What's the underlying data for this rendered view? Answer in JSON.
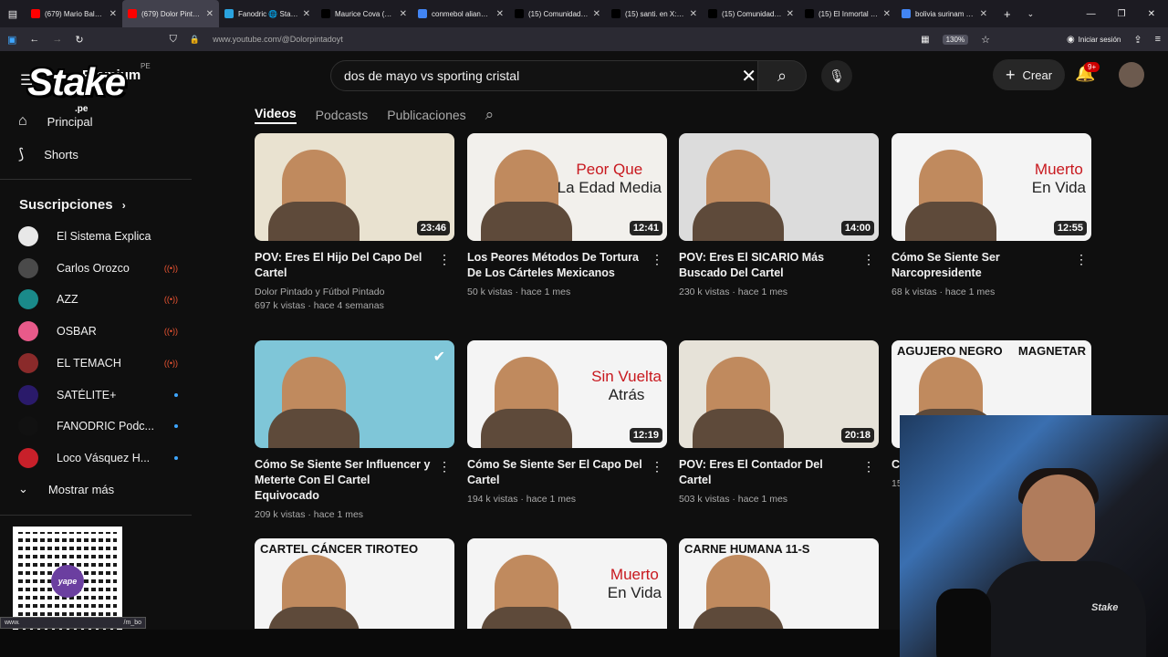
{
  "browser": {
    "tabs": [
      {
        "title": "(679) Mario Balotelli",
        "color": "#ff0000"
      },
      {
        "title": "(679) Dolor Pintado",
        "color": "#ff0000",
        "active": true
      },
      {
        "title": "Fanodric 🌐 Stake",
        "color": "#2aa3df"
      },
      {
        "title": "Maurice Cova (Cara",
        "color": "#000000"
      },
      {
        "title": "conmebol alianza li",
        "color": "#4285f4"
      },
      {
        "title": "(15) Comunidad Fa",
        "color": "#000000"
      },
      {
        "title": "(15) santi. en X: \"Ay",
        "color": "#000000"
      },
      {
        "title": "(15) Comunidades /",
        "color": "#000000"
      },
      {
        "title": "(15) El Inmortal 🇪🇸",
        "color": "#000000"
      },
      {
        "title": "bolivia surinam - Bu",
        "color": "#4285f4"
      }
    ],
    "url": "www.youtube.com/@Dolorpintadoyt",
    "zoom": "130%",
    "login": "Iniciar sesión",
    "status_url": "www.",
    "status_tail": "/m_bo"
  },
  "overlay": {
    "logo": "Stake",
    "logo_sub": ".pe",
    "premium": "Premium",
    "region": "PE"
  },
  "sidebar": {
    "home": "Principal",
    "shorts": "Shorts",
    "subs_title": "Suscripciones",
    "subs": [
      {
        "name": "El Sistema Explica",
        "avatar_color": "#e8e8e8",
        "indicator": "none"
      },
      {
        "name": "Carlos Orozco",
        "avatar_color": "#4a4a4a",
        "indicator": "live"
      },
      {
        "name": "AZZ",
        "avatar_color": "#1a8a8a",
        "indicator": "live"
      },
      {
        "name": "OSBAR",
        "avatar_color": "#e85a8a",
        "indicator": "live"
      },
      {
        "name": "EL TEMACH",
        "avatar_color": "#8a2a2a",
        "indicator": "live"
      },
      {
        "name": "SATÉLITE+",
        "avatar_color": "#2a1a6a",
        "indicator": "dot"
      },
      {
        "name": "FANODRIC Podc...",
        "avatar_color": "#111111",
        "indicator": "dot"
      },
      {
        "name": "Loco Vásquez H...",
        "avatar_color": "#c8202a",
        "indicator": "dot"
      }
    ],
    "more": "Mostrar más",
    "qr_label": "yape"
  },
  "search": {
    "value": "dos de mayo vs sporting cristal"
  },
  "header": {
    "create": "Crear",
    "notif": "9+"
  },
  "channel_tabs": [
    "Videos",
    "Podcasts",
    "Publicaciones"
  ],
  "videos": [
    {
      "title": "POV: Eres El Hijo Del Capo Del Cartel",
      "channel": "Dolor Pintado y Fútbol Pintado",
      "meta": "697 k vistas · hace 4 semanas",
      "duration": "23:46",
      "bg": "#e9e2d0",
      "thumb_a": "",
      "thumb_b": ""
    },
    {
      "title": "Los Peores Métodos De Tortura De Los Cárteles Mexicanos",
      "channel": "",
      "meta": "50 k vistas · hace 1 mes",
      "duration": "12:41",
      "bg": "#f2f0ec",
      "thumb_a": "Peor Que",
      "thumb_b": "La Edad Media"
    },
    {
      "title": "POV: Eres El SICARIO Más Buscado Del Cartel",
      "channel": "",
      "meta": "230 k vistas · hace 1 mes",
      "duration": "14:00",
      "bg": "#dcdcdc",
      "thumb_a": "",
      "thumb_b": ""
    },
    {
      "title": "Cómo Se Siente Ser Narcopresidente",
      "channel": "",
      "meta": "68 k vistas · hace 1 mes",
      "duration": "12:55",
      "bg": "#f4f4f4",
      "thumb_a": "Muerto",
      "thumb_b": "En Vida"
    },
    {
      "title": "Cómo Se Siente Ser Influencer y Meterte Con El Cartel Equivocado",
      "channel": "",
      "meta": "209 k vistas · hace 1 mes",
      "duration": "",
      "bg": "#7fc6d8",
      "thumb_a": "",
      "thumb_b": ""
    },
    {
      "title": "Cómo Se Siente Ser El Capo Del Cartel",
      "channel": "",
      "meta": "194 k vistas · hace 1 mes",
      "duration": "12:19",
      "bg": "#f4f4f4",
      "thumb_a": "Sin Vuelta",
      "thumb_b": "Atrás"
    },
    {
      "title": "POV: Eres El Contador Del Cartel",
      "channel": "",
      "meta": "503 k vistas · hace 1 mes",
      "duration": "20:18",
      "bg": "#e6e2d8",
      "thumb_a": "",
      "thumb_b": ""
    },
    {
      "title": "Có",
      "channel": "",
      "meta": "15",
      "duration": "",
      "bg": "#f4f4f4",
      "thumb_a": "AGUJERO NEGRO",
      "thumb_b": "MAGNETAR"
    },
    {
      "title": "",
      "channel": "",
      "meta": "",
      "duration": "",
      "bg": "#f4f4f4",
      "thumb_a": "CARTEL   CÁNCER   TIROTEO",
      "thumb_b": ""
    },
    {
      "title": "",
      "channel": "",
      "meta": "",
      "duration": "",
      "bg": "#f4f4f4",
      "thumb_a": "Muerto",
      "thumb_b": "En Vida"
    },
    {
      "title": "",
      "channel": "",
      "meta": "",
      "duration": "",
      "bg": "#f4f4f4",
      "thumb_a": "CARNE HUMANA      11-S",
      "thumb_b": ""
    }
  ],
  "webcam": {
    "brand": "Stake"
  }
}
